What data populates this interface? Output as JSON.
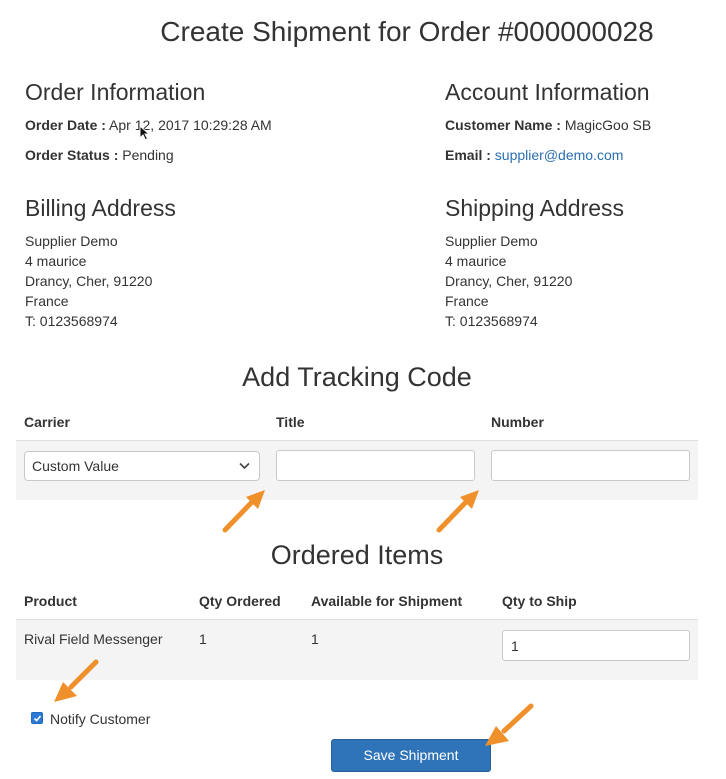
{
  "title": "Create Shipment for Order #000000028",
  "order_info": {
    "heading": "Order Information",
    "date_label": "Order Date :",
    "date_value": "Apr 12, 2017 10:29:28 AM",
    "status_label": "Order Status :",
    "status_value": "Pending"
  },
  "account_info": {
    "heading": "Account Information",
    "name_label": "Customer Name :",
    "name_value": "MagicGoo SB",
    "email_label": "Email :",
    "email_value": "supplier@demo.com"
  },
  "billing": {
    "heading": "Billing Address",
    "lines": [
      "Supplier Demo",
      "4 maurice",
      "Drancy, Cher, 91220",
      "France",
      "T: 0123568974"
    ]
  },
  "shipping": {
    "heading": "Shipping Address",
    "lines": [
      "Supplier Demo",
      "4 maurice",
      "Drancy, Cher, 91220",
      "France",
      "T: 0123568974"
    ]
  },
  "tracking": {
    "heading": "Add Tracking Code",
    "col_carrier": "Carrier",
    "col_title": "Title",
    "col_number": "Number",
    "carrier_value": "Custom Value",
    "title_value": "",
    "number_value": ""
  },
  "items": {
    "heading": "Ordered Items",
    "col_product": "Product",
    "col_qty_ordered": "Qty Ordered",
    "col_available": "Available for Shipment",
    "col_qty_ship": "Qty to Ship",
    "rows": [
      {
        "product": "Rival Field Messenger",
        "qty_ordered": "1",
        "available": "1",
        "qty_ship": "1"
      }
    ]
  },
  "notify": {
    "label": "Notify Customer",
    "checked": true
  },
  "save_label": "Save Shipment",
  "colors": {
    "accent": "#2f74b8",
    "link": "#2a6fb0",
    "annotation_arrow": "#f0902a"
  }
}
